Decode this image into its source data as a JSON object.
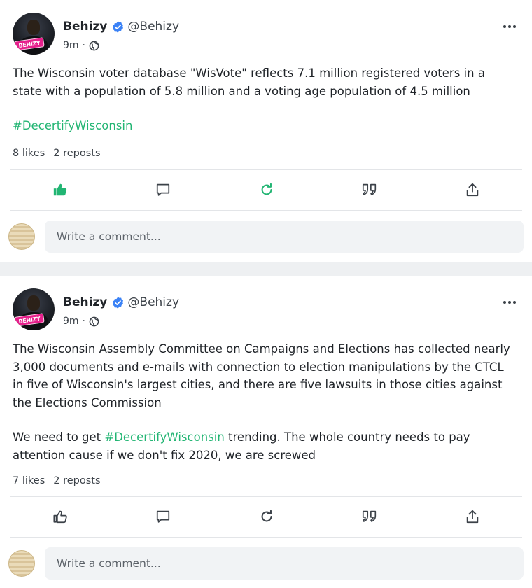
{
  "posts": [
    {
      "author": {
        "display_name": "Behizy",
        "handle": "@Behizy",
        "avatar_tag": "BEHIZY"
      },
      "time": "9m",
      "paragraphs": [
        {
          "parts": [
            {
              "text": "The Wisconsin voter database \"WisVote\" reflects 7.1 million registered voters in a state with a population of 5.8 million and a voting age population of 4.5 million"
            }
          ]
        },
        {
          "parts": [
            {
              "hashtag": "#DecertifyWisconsin"
            }
          ]
        }
      ],
      "likes": "8 likes",
      "reposts": "2 reposts",
      "liked": true,
      "reposted": true,
      "comment_placeholder": "Write a comment..."
    },
    {
      "author": {
        "display_name": "Behizy",
        "handle": "@Behizy",
        "avatar_tag": "BEHIZY"
      },
      "time": "9m",
      "paragraphs": [
        {
          "parts": [
            {
              "text": "The Wisconsin Assembly Committee on Campaigns and Elections has collected nearly 3,000 documents and e-mails with connection to election manipulations by the CTCL in five of Wisconsin's largest cities, and there are five lawsuits in those cities against the Elections Commission"
            }
          ]
        },
        {
          "parts": [
            {
              "text": "We need to get "
            },
            {
              "hashtag": "#DecertifyWisconsin"
            },
            {
              "text": " trending. The whole country needs to pay attention cause if we don't fix 2020, we are screwed"
            }
          ]
        }
      ],
      "likes": "7 likes",
      "reposts": "2 reposts",
      "liked": false,
      "reposted": false,
      "comment_placeholder": "Write a comment..."
    }
  ],
  "icons": {
    "verified": "verified-badge-icon",
    "visibility": "globe-icon",
    "more": "more-icon",
    "like": "thumbs-up-icon",
    "comment": "comment-icon",
    "repost": "repost-icon",
    "quote": "quote-icon",
    "share": "share-icon"
  },
  "colors": {
    "accent": "#22b573",
    "verified": "#3b82f6",
    "icon_default": "#3b4148"
  }
}
